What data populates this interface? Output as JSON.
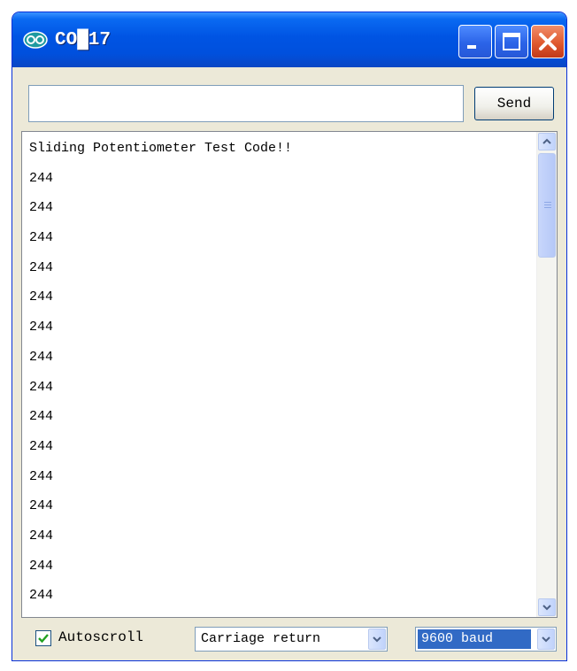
{
  "window": {
    "title": "CO█17",
    "icon": "arduino-icon",
    "controls": [
      "minimize-icon",
      "maximize-icon",
      "close-icon"
    ]
  },
  "send_bar": {
    "input_value": "",
    "send_label": "Send"
  },
  "output": {
    "lines": [
      "Sliding Potentiometer Test Code!!",
      "244",
      "244",
      "244",
      "244",
      "244",
      "244",
      "244",
      "244",
      "244",
      "244",
      "244",
      "244",
      "244",
      "244",
      "244"
    ]
  },
  "footer": {
    "autoscroll_label": "Autoscroll",
    "autoscroll_checked": true,
    "line_ending": "Carriage return",
    "baud": "9600 baud"
  },
  "colors": {
    "titlebar": "#0054e3",
    "close_button": "#e05a2f",
    "selection": "#316ac5",
    "window_face": "#ece9d8"
  }
}
